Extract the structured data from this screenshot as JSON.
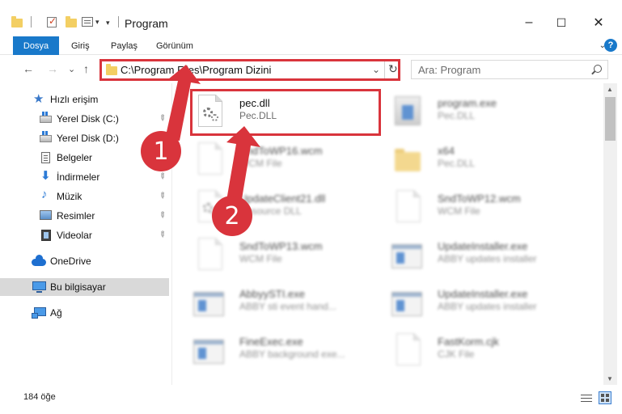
{
  "window": {
    "title": "Program",
    "minimize": "–",
    "maximize": "☐",
    "close": "✕",
    "quick_access_dropdown": "▾"
  },
  "ribbon": {
    "tabs": [
      "Dosya",
      "Giriş",
      "Paylaş",
      "Görünüm"
    ],
    "expand": "⌄",
    "help": "?"
  },
  "navigation": {
    "back": "←",
    "forward": "→",
    "recent": "⌄",
    "up": "↑",
    "address_path": "C:\\Program Files\\Program Dizini",
    "address_chevron": "⌄",
    "refresh": "↻",
    "search_placeholder": "Ara: Program"
  },
  "sidebar": {
    "items": [
      {
        "label": "Hızlı erişim",
        "icon": "star-icon"
      },
      {
        "label": "Yerel Disk (C:)",
        "icon": "drive-icon",
        "pinned": true
      },
      {
        "label": "Yerel Disk (D:)",
        "icon": "drive-icon",
        "pinned": true
      },
      {
        "label": "Belgeler",
        "icon": "document-icon",
        "pinned": true
      },
      {
        "label": "İndirmeler",
        "icon": "download-icon",
        "pinned": true
      },
      {
        "label": "Müzik",
        "icon": "music-icon",
        "pinned": true
      },
      {
        "label": "Resimler",
        "icon": "pictures-icon",
        "pinned": true
      },
      {
        "label": "Videolar",
        "icon": "video-icon",
        "pinned": true
      },
      {
        "label": "OneDrive",
        "icon": "cloud-icon"
      },
      {
        "label": "Bu bilgisayar",
        "icon": "computer-icon",
        "selected": true
      },
      {
        "label": "Ağ",
        "icon": "network-icon"
      }
    ],
    "pin_glyph": "📌"
  },
  "files": [
    {
      "name": "pec.dll",
      "type": "Pec.DLL",
      "icon": "dll-gear-icon",
      "highlighted": true
    },
    {
      "name": "program.exe",
      "type": "Pec.DLL",
      "icon": "installer-icon"
    },
    {
      "name": "SndToWP16.wcm",
      "type": "WCM File",
      "icon": "blank-file-icon"
    },
    {
      "name": "x64",
      "type": "Pec.DLL",
      "icon": "folder-icon"
    },
    {
      "name": "UpdateClient21.dll",
      "type": "Resource DLL",
      "icon": "dll-gear-icon"
    },
    {
      "name": "SndToWP12.wcm",
      "type": "WCM File",
      "icon": "blank-file-icon"
    },
    {
      "name": "SndToWP13.wcm",
      "type": "WCM File",
      "icon": "blank-file-icon"
    },
    {
      "name": "UpdateInstaller.exe",
      "type": "ABBY updates installer",
      "icon": "exe-icon"
    },
    {
      "name": "AbbyySTI.exe",
      "type": "ABBY sti event hand...",
      "icon": "exe-icon"
    },
    {
      "name": "UpdateInstaller.exe",
      "type": "ABBY updates installer",
      "icon": "exe-icon"
    },
    {
      "name": "FineExec.exe",
      "type": "ABBY background exe...",
      "icon": "exe-icon"
    },
    {
      "name": "FastKorm.cjk",
      "type": "CJK File",
      "icon": "blank-file-icon"
    }
  ],
  "status": {
    "item_count": "184 öğe"
  },
  "annotations": {
    "badge_1": "1",
    "badge_2": "2",
    "color": "#d9343c"
  }
}
